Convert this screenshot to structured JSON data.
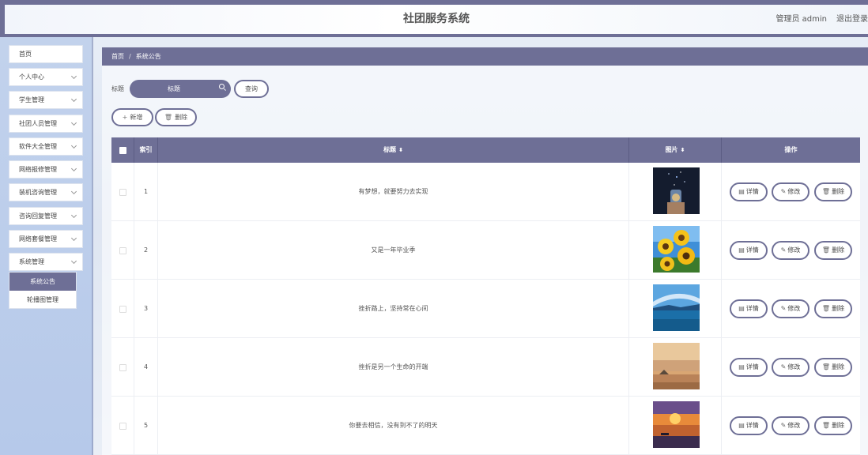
{
  "header": {
    "title": "社团服务系统",
    "user": "管理员 admin",
    "logout": "退出登录"
  },
  "sidebar": {
    "items": [
      {
        "label": "首页"
      },
      {
        "label": "个人中心"
      },
      {
        "label": "学生管理"
      },
      {
        "label": "社团人员管理"
      },
      {
        "label": "软件大全管理"
      },
      {
        "label": "网络报修管理"
      },
      {
        "label": "装机咨询管理"
      },
      {
        "label": "咨询回复管理"
      },
      {
        "label": "网络套餐管理"
      },
      {
        "label": "系统管理"
      }
    ],
    "submenu": [
      {
        "label": "系统公告",
        "active": true
      },
      {
        "label": "轮播图管理",
        "active": false
      }
    ]
  },
  "breadcrumb": {
    "home": "首页",
    "separator": "/",
    "current": "系统公告"
  },
  "search": {
    "label": "标题",
    "placeholder": "标题",
    "button": "查询"
  },
  "actions": {
    "add": "新增",
    "delete": "删除"
  },
  "table": {
    "headers": {
      "index": "索引",
      "title": "标题",
      "image": "图片",
      "ops": "操作"
    },
    "row_actions": {
      "detail": "详情",
      "edit": "修改",
      "delete": "删除"
    },
    "rows": [
      {
        "index": "1",
        "title": "有梦想，就要努力去实现"
      },
      {
        "index": "2",
        "title": "又是一年毕业季"
      },
      {
        "index": "3",
        "title": "挫折路上，坚持常在心间"
      },
      {
        "index": "4",
        "title": "挫折是另一个生命的开端"
      },
      {
        "index": "5",
        "title": "你要去相信，没有到不了的明天"
      }
    ]
  },
  "colors": {
    "accent": "#6e6f96"
  }
}
